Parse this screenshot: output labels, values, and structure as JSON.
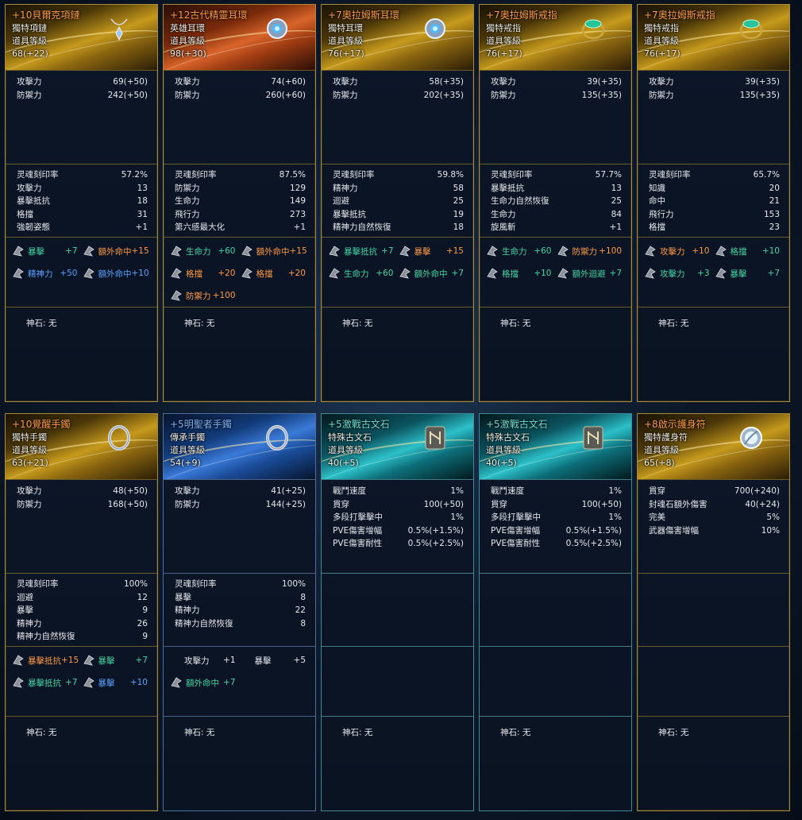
{
  "rows": [
    [
      {
        "name": "+10貝爾克項鏈",
        "name_color": "orange",
        "theme": "gold",
        "type": "獨特項鏈",
        "level_label": "道具等級",
        "level": "68(+22)",
        "icon": "necklace-icon",
        "stats": [
          [
            "攻擊力",
            "69(+50)"
          ],
          [
            "防禦力",
            "242(+50)"
          ]
        ],
        "soul": [
          [
            "灵魂刻印率",
            "57.2%"
          ],
          [
            "攻擊力",
            "13"
          ],
          [
            "暴擊抵抗",
            "18"
          ],
          [
            "格擋",
            "31"
          ],
          [
            "強韌姿態",
            "+1"
          ]
        ],
        "runes": [
          [
            "暴擊",
            "+7",
            "green"
          ],
          [
            "額外命中",
            "+15",
            "orange"
          ],
          [
            "精神力",
            "+50",
            "blue"
          ],
          [
            "額外命中",
            "+10",
            "blue"
          ]
        ],
        "god": "神石: 无"
      },
      {
        "name": "+12古代精靈耳環",
        "name_color": "orange",
        "theme": "red",
        "type": "英雄耳環",
        "level_label": "道具等級",
        "level": "98(+30)",
        "icon": "earring-icon",
        "stats": [
          [
            "攻擊力",
            "74(+60)"
          ],
          [
            "防禦力",
            "260(+60)"
          ]
        ],
        "soul": [
          [
            "灵魂刻印率",
            "87.5%"
          ],
          [
            "防禦力",
            "129"
          ],
          [
            "生命力",
            "149"
          ],
          [
            "飛行力",
            "273"
          ],
          [
            "第六感最大化",
            "+1"
          ]
        ],
        "runes": [
          [
            "生命力",
            "+60",
            "green"
          ],
          [
            "額外命中",
            "+15",
            "orange"
          ],
          [
            "格擋",
            "+20",
            "orange"
          ],
          [
            "格擋",
            "+20",
            "orange"
          ],
          [
            "防禦力",
            "+100",
            "orange"
          ]
        ],
        "god": "神石: 无"
      },
      {
        "name": "+7奧拉姆斯耳環",
        "name_color": "orange",
        "theme": "gold",
        "type": "獨特耳環",
        "level_label": "道具等級",
        "level": "76(+17)",
        "icon": "earring-icon",
        "stats": [
          [
            "攻擊力",
            "58(+35)"
          ],
          [
            "防禦力",
            "202(+35)"
          ]
        ],
        "soul": [
          [
            "灵魂刻印率",
            "59.8%"
          ],
          [
            "精神力",
            "58"
          ],
          [
            "迴避",
            "25"
          ],
          [
            "暴擊抵抗",
            "19"
          ],
          [
            "精神力自然恢復",
            "18"
          ]
        ],
        "runes": [
          [
            "暴擊抵抗",
            "+7",
            "green"
          ],
          [
            "暴擊",
            "+15",
            "orange"
          ],
          [
            "生命力",
            "+60",
            "green"
          ],
          [
            "額外命中",
            "+7",
            "green"
          ]
        ],
        "god": "神石: 无"
      },
      {
        "name": "+7奧拉姆斯戒指",
        "name_color": "orange",
        "theme": "gold",
        "type": "獨特戒指",
        "level_label": "道具等級",
        "level": "76(+17)",
        "icon": "ring-icon",
        "stats": [
          [
            "攻擊力",
            "39(+35)"
          ],
          [
            "防禦力",
            "135(+35)"
          ]
        ],
        "soul": [
          [
            "灵魂刻印率",
            "57.7%"
          ],
          [
            "暴擊抵抗",
            "13"
          ],
          [
            "生命力自然恢復",
            "25"
          ],
          [
            "生命力",
            "84"
          ],
          [
            "旋風斬",
            "+1"
          ]
        ],
        "runes": [
          [
            "生命力",
            "+60",
            "green"
          ],
          [
            "防禦力",
            "+100",
            "orange"
          ],
          [
            "格擋",
            "+10",
            "green"
          ],
          [
            "額外迴避",
            "+7",
            "green"
          ]
        ],
        "god": "神石: 无"
      },
      {
        "name": "+7奧拉姆斯戒指",
        "name_color": "orange",
        "theme": "gold",
        "type": "獨特戒指",
        "level_label": "道具等級",
        "level": "76(+17)",
        "icon": "ring-icon",
        "stats": [
          [
            "攻擊力",
            "39(+35)"
          ],
          [
            "防禦力",
            "135(+35)"
          ]
        ],
        "soul": [
          [
            "灵魂刻印率",
            "65.7%"
          ],
          [
            "知識",
            "20"
          ],
          [
            "命中",
            "21"
          ],
          [
            "飛行力",
            "153"
          ],
          [
            "格擋",
            "23"
          ]
        ],
        "runes": [
          [
            "攻擊力",
            "+10",
            "orange"
          ],
          [
            "格擋",
            "+10",
            "green"
          ],
          [
            "攻擊力",
            "+3",
            "green"
          ],
          [
            "暴擊",
            "+7",
            "green"
          ]
        ],
        "god": "神石: 无"
      }
    ],
    [
      {
        "name": "+10覺醒手鐲",
        "name_color": "orange",
        "theme": "gold",
        "type": "獨特手鐲",
        "level_label": "道具等級",
        "level": "63(+21)",
        "icon": "bracelet-icon",
        "stats": [
          [
            "攻擊力",
            "48(+50)"
          ],
          [
            "防禦力",
            "168(+50)"
          ]
        ],
        "soul": [
          [
            "灵魂刻印率",
            "100%"
          ],
          [
            "迴避",
            "12"
          ],
          [
            "暴擊",
            "9"
          ],
          [
            "精神力",
            "26"
          ],
          [
            "精神力自然恢復",
            "9"
          ]
        ],
        "runes": [
          [
            "暴擊抵抗",
            "+15",
            "orange"
          ],
          [
            "暴擊",
            "+7",
            "green"
          ],
          [
            "暴擊抵抗",
            "+7",
            "green"
          ],
          [
            "暴擊",
            "+10",
            "blue"
          ]
        ],
        "god": "神石: 无"
      },
      {
        "name": "+5明聖者手鐲",
        "name_color": "blue",
        "theme": "blue",
        "type": "傳承手鐲",
        "level_label": "道具等級",
        "level": "54(+9)",
        "icon": "bracelet-icon",
        "stats": [
          [
            "攻擊力",
            "41(+25)"
          ],
          [
            "防禦力",
            "144(+25)"
          ]
        ],
        "soul": [
          [
            "灵魂刻印率",
            "100%"
          ],
          [
            "暴擊",
            "8"
          ],
          [
            "精神力",
            "22"
          ],
          [
            "精神力自然恢復",
            "8"
          ]
        ],
        "runes": [
          [
            "攻擊力",
            "+1",
            "white"
          ],
          [
            "暴擊",
            "+5",
            "white"
          ],
          [
            "額外命中",
            "+7",
            "green"
          ]
        ],
        "god": "神石: 无"
      },
      {
        "name": "+5激戰古文石",
        "name_color": "cyan",
        "theme": "cyan",
        "type": "特殊古文石",
        "level_label": "道具等級",
        "level": "40(+5)",
        "icon": "rune-stone-icon",
        "stats": [
          [
            "戰鬥速度",
            "1%"
          ],
          [
            "貫穿",
            "100(+50)"
          ],
          [
            "多段打擊擊中",
            "1%"
          ],
          [
            "PVE傷害增幅",
            "0.5%(+1.5%)"
          ],
          [
            "PVE傷害耐性",
            "0.5%(+2.5%)"
          ]
        ],
        "soul": [],
        "runes": [],
        "god": "神石: 无"
      },
      {
        "name": "+5激戰古文石",
        "name_color": "cyan",
        "theme": "cyan",
        "type": "特殊古文石",
        "level_label": "道具等級",
        "level": "40(+5)",
        "icon": "rune-stone-icon",
        "stats": [
          [
            "戰鬥速度",
            "1%"
          ],
          [
            "貫穿",
            "100(+50)"
          ],
          [
            "多段打擊擊中",
            "1%"
          ],
          [
            "PVE傷害增幅",
            "0.5%(+1.5%)"
          ],
          [
            "PVE傷害耐性",
            "0.5%(+2.5%)"
          ]
        ],
        "soul": [],
        "runes": [],
        "god": "神石: 无"
      },
      {
        "name": "+8啟示護身符",
        "name_color": "orange",
        "theme": "gold",
        "type": "獨特護身符",
        "level_label": "道具等級",
        "level": "65(+8)",
        "icon": "amulet-icon",
        "stats": [
          [
            "貫穿",
            "700(+240)"
          ],
          [
            "封魂石額外傷害",
            "40(+24)"
          ],
          [
            "完美",
            "5%"
          ],
          [
            "武器傷害增幅",
            "10%"
          ]
        ],
        "soul": [],
        "runes": [],
        "god": "神石: 无"
      }
    ]
  ]
}
